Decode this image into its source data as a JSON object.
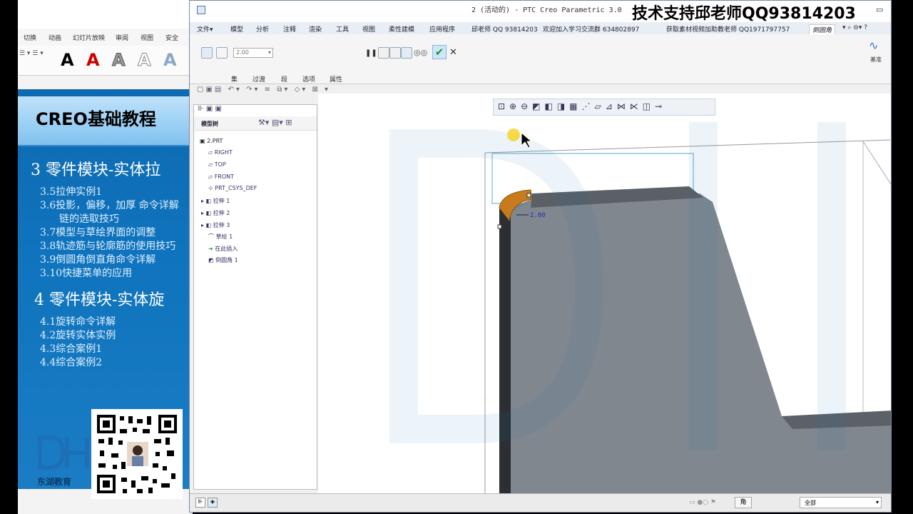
{
  "ppt": {
    "tabs": [
      "切换",
      "动画",
      "幻灯片放映",
      "审阅",
      "视图",
      "安全"
    ],
    "styles_letter": "A",
    "slide_title": "CREO基础教程",
    "outline": {
      "h1a": "3 零件模块-实体拉",
      "items_a": [
        "3.5拉伸实例1",
        "3.6投影，偏移，加厚 命令详解",
        "链的选取技巧",
        "3.7模型与草绘界面的调整",
        "3.8轨迹筋与轮廓筋的使用技巧",
        "3.9倒圆角倒直角命令详解",
        "3.10快捷菜单的应用"
      ],
      "h1b": "4 零件模块-实体旋",
      "items_b": [
        "4.1旋转命令详解",
        "4.2旋转实体实例",
        "4.3综合案例1",
        "4.4综合案例2"
      ]
    },
    "logo_text": "东湖教育"
  },
  "creo": {
    "title": "2 (活动的) - PTC Creo Parametric 3.0",
    "watermark": "技术支持邱老师QQ93814203",
    "menus": [
      "文件▾",
      "模型",
      "分析",
      "注释",
      "渲染",
      "工具",
      "视图",
      "柔性建模",
      "应用程序",
      "邱老师 QQ 93814203",
      "欢迎加入学习交流群 634802897",
      "获取素材视频加助教老师 QQ1971797757",
      "倒圆角"
    ],
    "ribbon": {
      "radius_value": "2.00",
      "tabs": [
        "集",
        "过渡",
        "段",
        "选项",
        "属性"
      ],
      "right_label": "基准"
    },
    "tree": {
      "header": "模型树",
      "items": [
        "2.PRT",
        "RIGHT",
        "TOP",
        "FRONT",
        "PRT_CSYS_DEF",
        "拉伸 1",
        "拉伸 2",
        "拉伸 3",
        "草绘 1",
        "在此插入",
        "倒圆角 1"
      ]
    },
    "dimension": "2.00",
    "status": {
      "filter": "全部",
      "ja": "角"
    }
  }
}
